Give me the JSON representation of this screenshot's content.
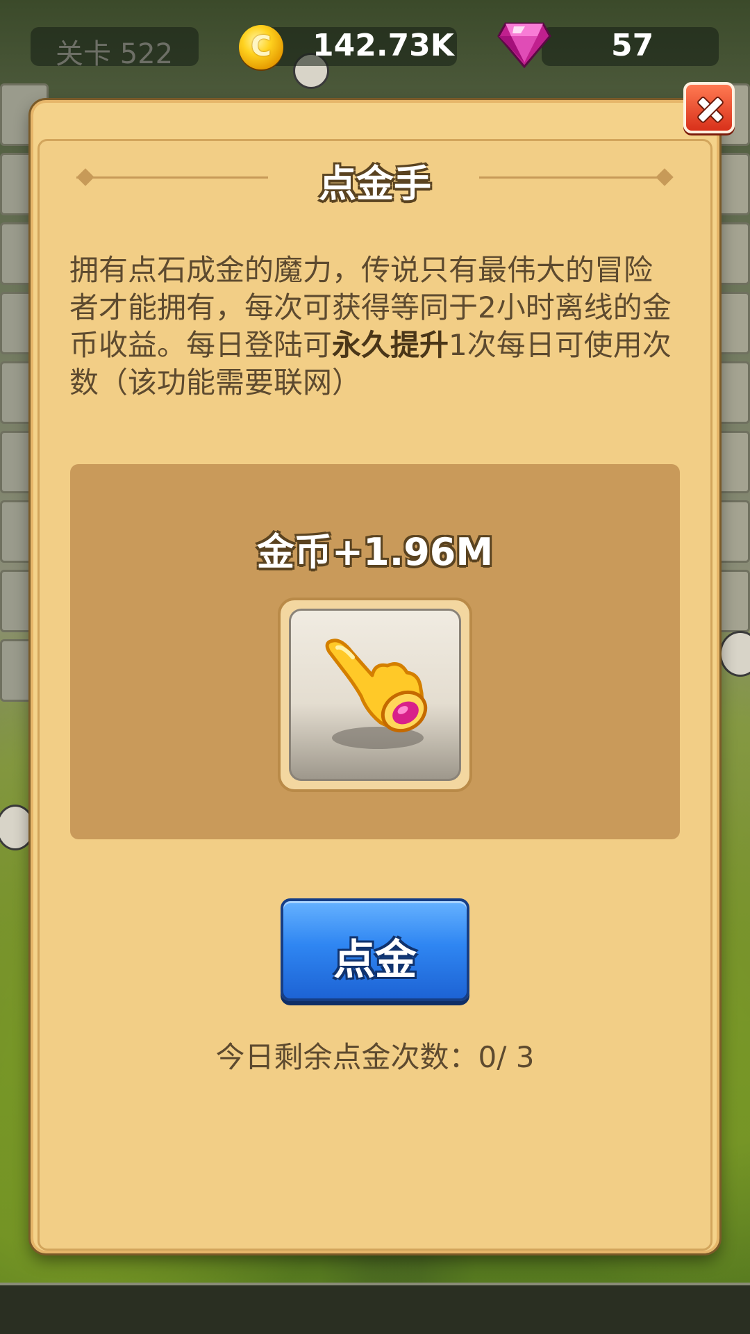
{
  "hud": {
    "level_label": "关卡 522",
    "coins": "142.73K",
    "gems": "57"
  },
  "dialog": {
    "title": "点金手",
    "description_part1": "拥有点石成金的魔力，传说只有最伟大的冒险者才能拥有，每次可获得等同于2小时离线的金币收益。每日登陆可",
    "description_bold": "永久提升",
    "description_part2": "1次每日可使用次数（该功能需要联网）",
    "reward": "金币+1.96M",
    "action_label": "点金",
    "remaining": "今日剩余点金次数：0/ 3"
  },
  "icons": {
    "coin": "coin-icon",
    "gem": "gem-icon",
    "close": "close-icon",
    "midas": "golden-hand-icon"
  },
  "colors": {
    "panel": "#f4d28a",
    "reward_box": "#c99a5a",
    "button": "#2f86f2",
    "close": "#d8301a",
    "text": "#5d4a2f"
  }
}
